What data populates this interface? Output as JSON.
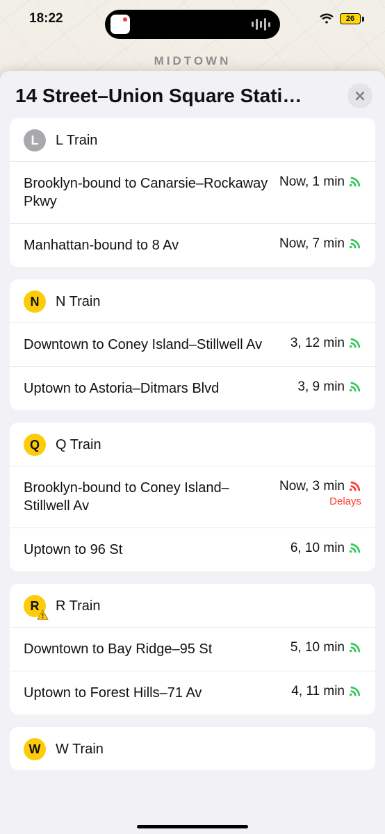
{
  "status_bar": {
    "time": "18:22",
    "battery_pct": "26"
  },
  "map": {
    "district_label": "MIDTOWN"
  },
  "sheet": {
    "title": "14 Street–Union Square Stati…"
  },
  "colors": {
    "L": "#a7a9ac",
    "N": "#fccc0a",
    "Q": "#fccc0a",
    "R": "#fccc0a",
    "W": "#fccc0a",
    "rss_ok": "#34c759",
    "rss_delay": "#ff3b30"
  },
  "lines": [
    {
      "id": "L",
      "letter": "L",
      "name": "L Train",
      "dark_letter": false,
      "alert": false,
      "rows": [
        {
          "dest": "Brooklyn-bound to Canarsie–Rockaway Pkwy",
          "eta": "Now, 1 min",
          "status": "ok"
        },
        {
          "dest": "Manhattan-bound to 8 Av",
          "eta": "Now, 7 min",
          "status": "ok"
        }
      ]
    },
    {
      "id": "N",
      "letter": "N",
      "name": "N Train",
      "dark_letter": true,
      "alert": false,
      "rows": [
        {
          "dest": "Downtown to Coney Island–Stillwell Av",
          "eta": "3, 12 min",
          "status": "ok"
        },
        {
          "dest": "Uptown to Astoria–Ditmars Blvd",
          "eta": "3, 9 min",
          "status": "ok"
        }
      ]
    },
    {
      "id": "Q",
      "letter": "Q",
      "name": "Q Train",
      "dark_letter": true,
      "alert": false,
      "rows": [
        {
          "dest": "Brooklyn-bound to Coney Island–Stillwell Av",
          "eta": "Now, 3 min",
          "status": "delay",
          "delay_label": "Delays"
        },
        {
          "dest": "Uptown to 96 St",
          "eta": "6, 10 min",
          "status": "ok"
        }
      ]
    },
    {
      "id": "R",
      "letter": "R",
      "name": "R Train",
      "dark_letter": true,
      "alert": true,
      "rows": [
        {
          "dest": "Downtown to Bay Ridge–95 St",
          "eta": "5, 10 min",
          "status": "ok"
        },
        {
          "dest": "Uptown to Forest Hills–71 Av",
          "eta": "4, 11 min",
          "status": "ok"
        }
      ]
    },
    {
      "id": "W",
      "letter": "W",
      "name": "W Train",
      "dark_letter": true,
      "alert": false,
      "rows": []
    }
  ]
}
